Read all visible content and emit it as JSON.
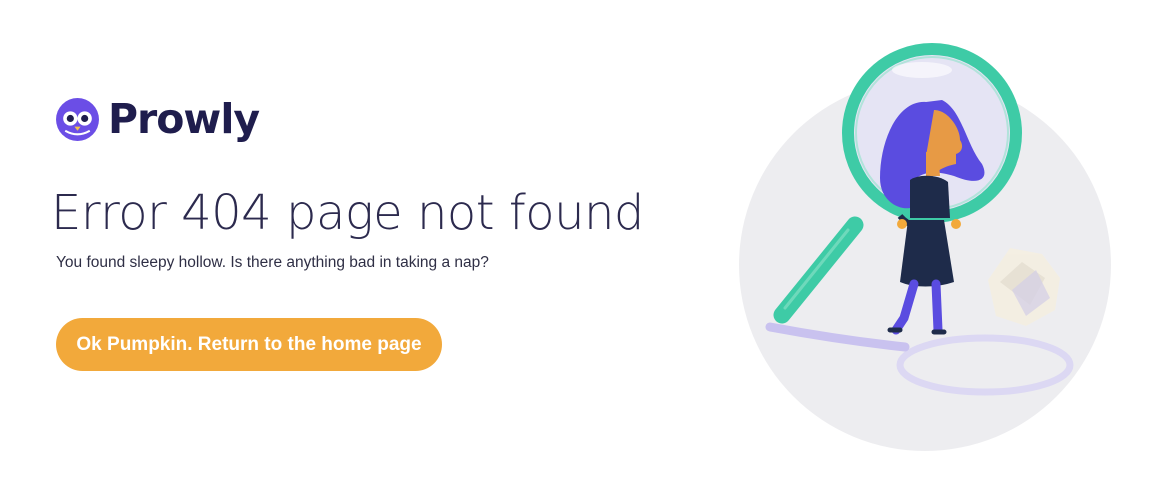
{
  "brand": {
    "name": "Prowly",
    "logo_icon": "owl-icon",
    "color": "#1f1d4d",
    "accent": "#6b4ee6"
  },
  "error": {
    "title": "Error 404 page not found",
    "subtitle": "You found sleepy hollow. Is there anything bad in taking a nap?"
  },
  "actions": {
    "home_label": "Ok Pumpkin. Return to the home page",
    "button_color": "#f2a93b"
  },
  "illustration": {
    "icon": "magnifying-glass-woman-illustration",
    "colors": {
      "lens_frame": "#3ecba6",
      "hair": "#5a4ce0",
      "skin": "#e79a45",
      "dress": "#1e2b4a",
      "backdrop": "#ededf0"
    }
  }
}
